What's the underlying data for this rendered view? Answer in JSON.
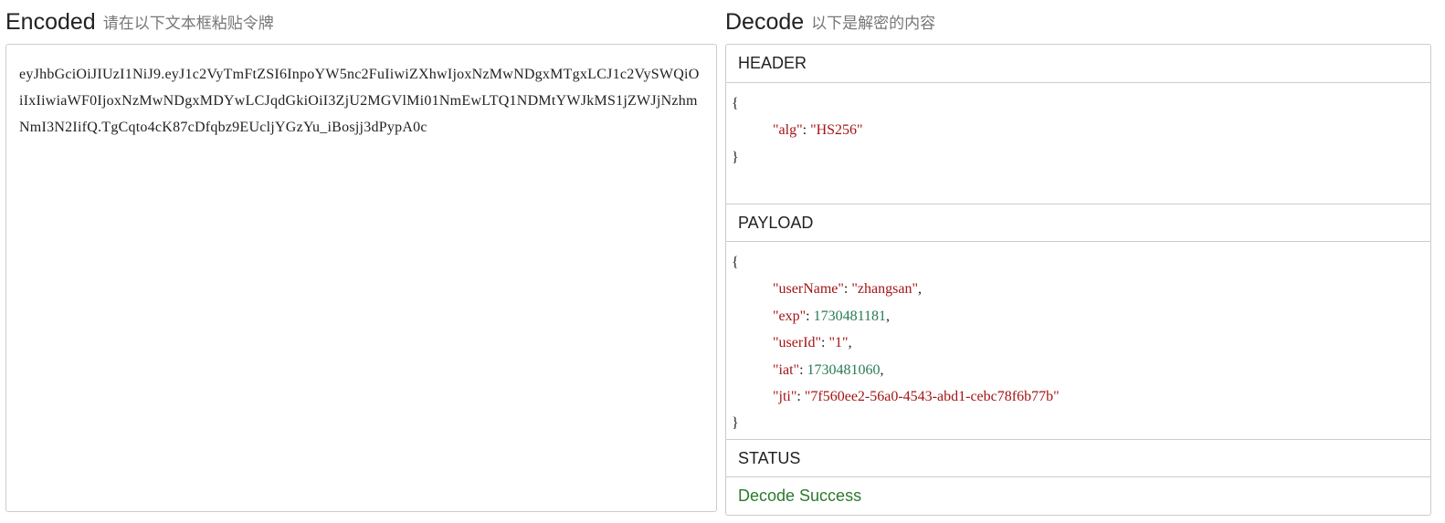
{
  "encoded": {
    "title": "Encoded",
    "subtitle": "请在以下文本框粘贴令牌",
    "token": "eyJhbGciOiJIUzI1NiJ9.eyJ1c2VyTmFtZSI6InpoYW5nc2FuIiwiZXhwIjoxNzMwNDgxMTgxLCJ1c2VySWQiOiIxIiwiaWF0IjoxNzMwNDgxMDYwLCJqdGkiOiI3ZjU2MGVlMi01NmEwLTQ1NDMtYWJkMS1jZWJjNzhmNmI3N2IifQ.TgCqto4cK87cDfqbz9EUcljYGzYu_iBosjj3dPypA0c"
  },
  "decode": {
    "title": "Decode",
    "subtitle": "以下是解密的内容",
    "header": {
      "label": "HEADER",
      "open": "{",
      "close": "}",
      "lines": [
        {
          "key": "\"alg\"",
          "sep": ": ",
          "value": "\"HS256\"",
          "type": "string",
          "tail": ""
        }
      ]
    },
    "payload": {
      "label": "PAYLOAD",
      "open": "{",
      "close": "}",
      "lines": [
        {
          "key": "\"userName\"",
          "sep": ": ",
          "value": "\"zhangsan\"",
          "type": "string",
          "tail": ","
        },
        {
          "key": "\"exp\"",
          "sep": ": ",
          "value": "1730481181",
          "type": "number",
          "tail": ","
        },
        {
          "key": "\"userId\"",
          "sep": ": ",
          "value": "\"1\"",
          "type": "string",
          "tail": ","
        },
        {
          "key": "\"iat\"",
          "sep": ": ",
          "value": "1730481060",
          "type": "number",
          "tail": ","
        },
        {
          "key": "\"jti\"",
          "sep": ": ",
          "value": "\"7f560ee2-56a0-4543-abd1-cebc78f6b77b\"",
          "type": "string",
          "tail": ""
        }
      ]
    },
    "status": {
      "label": "STATUS",
      "text": "Decode Success"
    }
  },
  "colors": {
    "json_key": "#a31515",
    "json_string": "#a31515",
    "json_number": "#2a7b54",
    "status_success": "#2b7a2b",
    "border": "#cccccc"
  }
}
